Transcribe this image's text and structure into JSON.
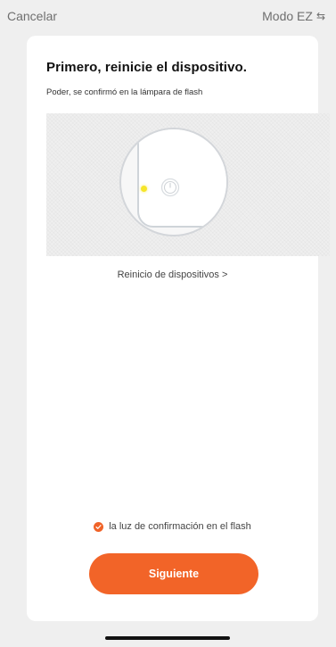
{
  "header": {
    "cancel_label": "Cancelar",
    "mode_label": "Modo EZ",
    "mode_icon": "swap-arrows-icon"
  },
  "main": {
    "title": "Primero, reinicie el dispositivo.",
    "subtitle": "Poder, se confirmó en la lámpara de flash",
    "illustration": {
      "led_color": "#f6e52a",
      "icon": "power-icon"
    },
    "reset_link_label": "Reinicio de dispositivos >",
    "confirm_label": "la luz de confirmación en el flash",
    "confirm_checked": true,
    "next_button_label": "Siguiente"
  },
  "colors": {
    "accent": "#f26428",
    "background": "#efefef",
    "card": "#ffffff"
  }
}
